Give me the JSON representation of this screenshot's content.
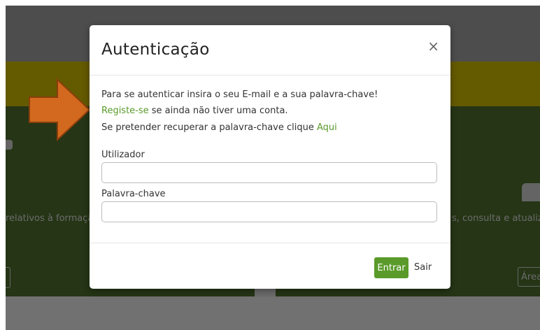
{
  "background": {
    "left_text": "relativos à formaçã",
    "right_text": "s, consulta e atualiz",
    "right_button_label": "Área"
  },
  "colors": {
    "accent_green": "#5a9a2a",
    "arrow_orange": "#d2691e",
    "yellow_band": "#c9b400",
    "dark_green": "#4a6b2a"
  },
  "icons": {
    "close": "close-icon",
    "arrow": "arrow-right-icon"
  },
  "modal": {
    "title": "Autenticação",
    "close_symbol": "×",
    "intro_text": "Para se autenticar insira o seu E-mail e a sua palavra-chave!",
    "register_link": "Registe-se",
    "register_suffix": " se ainda não tiver uma conta.",
    "recover_prefix": "Se pretender recuperar a palavra-chave clique ",
    "recover_link": "Aqui",
    "username_label": "Utilizador",
    "username_value": "",
    "password_label": "Palavra-chave",
    "password_value": "",
    "submit_label": "Entrar",
    "exit_label": "Sair"
  }
}
